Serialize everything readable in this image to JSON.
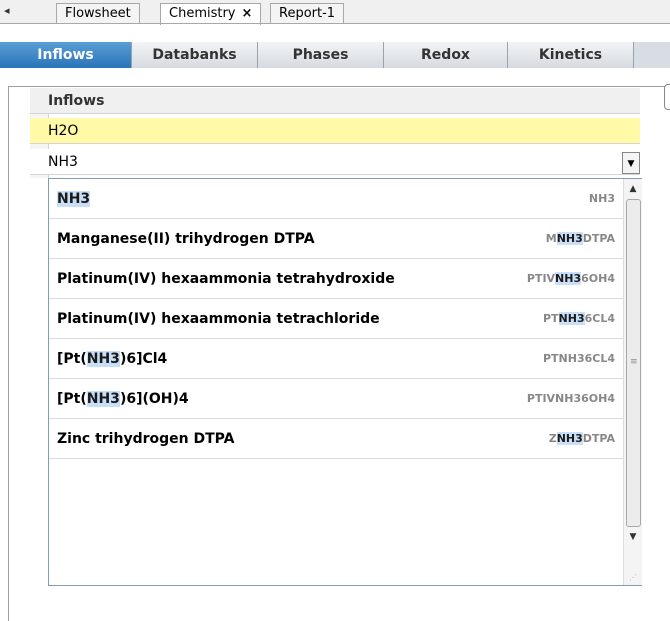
{
  "doc_tabs": {
    "arrow": "◂",
    "items": [
      {
        "label": "Flowsheet"
      },
      {
        "label": "Chemistry",
        "close": "×"
      },
      {
        "label": "Report-1"
      }
    ]
  },
  "sub_tabs": [
    "Inflows",
    "Databanks",
    "Phases",
    "Redox",
    "Kinetics"
  ],
  "grid": {
    "header": "Inflows",
    "rows": [
      "H2O",
      "NH3"
    ]
  },
  "dropdown": {
    "items": [
      {
        "name": "NH3",
        "formula": "NH3"
      },
      {
        "name_parts": [
          "Manganese(II) trihydrogen DTPA"
        ],
        "formula_parts": [
          "M",
          "NH3",
          "DTPA"
        ]
      },
      {
        "name_parts": [
          "Platinum(IV) hexaammonia tetrahydroxide"
        ],
        "formula_parts": [
          "PTIV",
          "NH3",
          "6OH4"
        ]
      },
      {
        "name_parts": [
          "Platinum(IV) hexaammonia tetrachloride"
        ],
        "formula_parts": [
          "PT",
          "NH3",
          "6CL4"
        ]
      },
      {
        "name_parts": [
          "[Pt(",
          "NH3",
          ")6]Cl4"
        ],
        "formula": "PTNH36CL4"
      },
      {
        "name_parts": [
          "[Pt(",
          "NH3",
          ")6](OH)4"
        ],
        "formula": "PTIVNH36OH4"
      },
      {
        "name_parts": [
          "Zinc trihydrogen DTPA"
        ],
        "formula_parts": [
          "Z",
          "NH3",
          "DTPA"
        ]
      }
    ]
  },
  "icons": {
    "dropdown": "▼",
    "scroll_up": "▲",
    "scroll_down": "▼",
    "grip": "≡",
    "resize": "⋰"
  },
  "colors": {
    "active_tab": "#2a74b8",
    "selected_row": "#fff9a8",
    "highlight": "#c9dff8"
  }
}
